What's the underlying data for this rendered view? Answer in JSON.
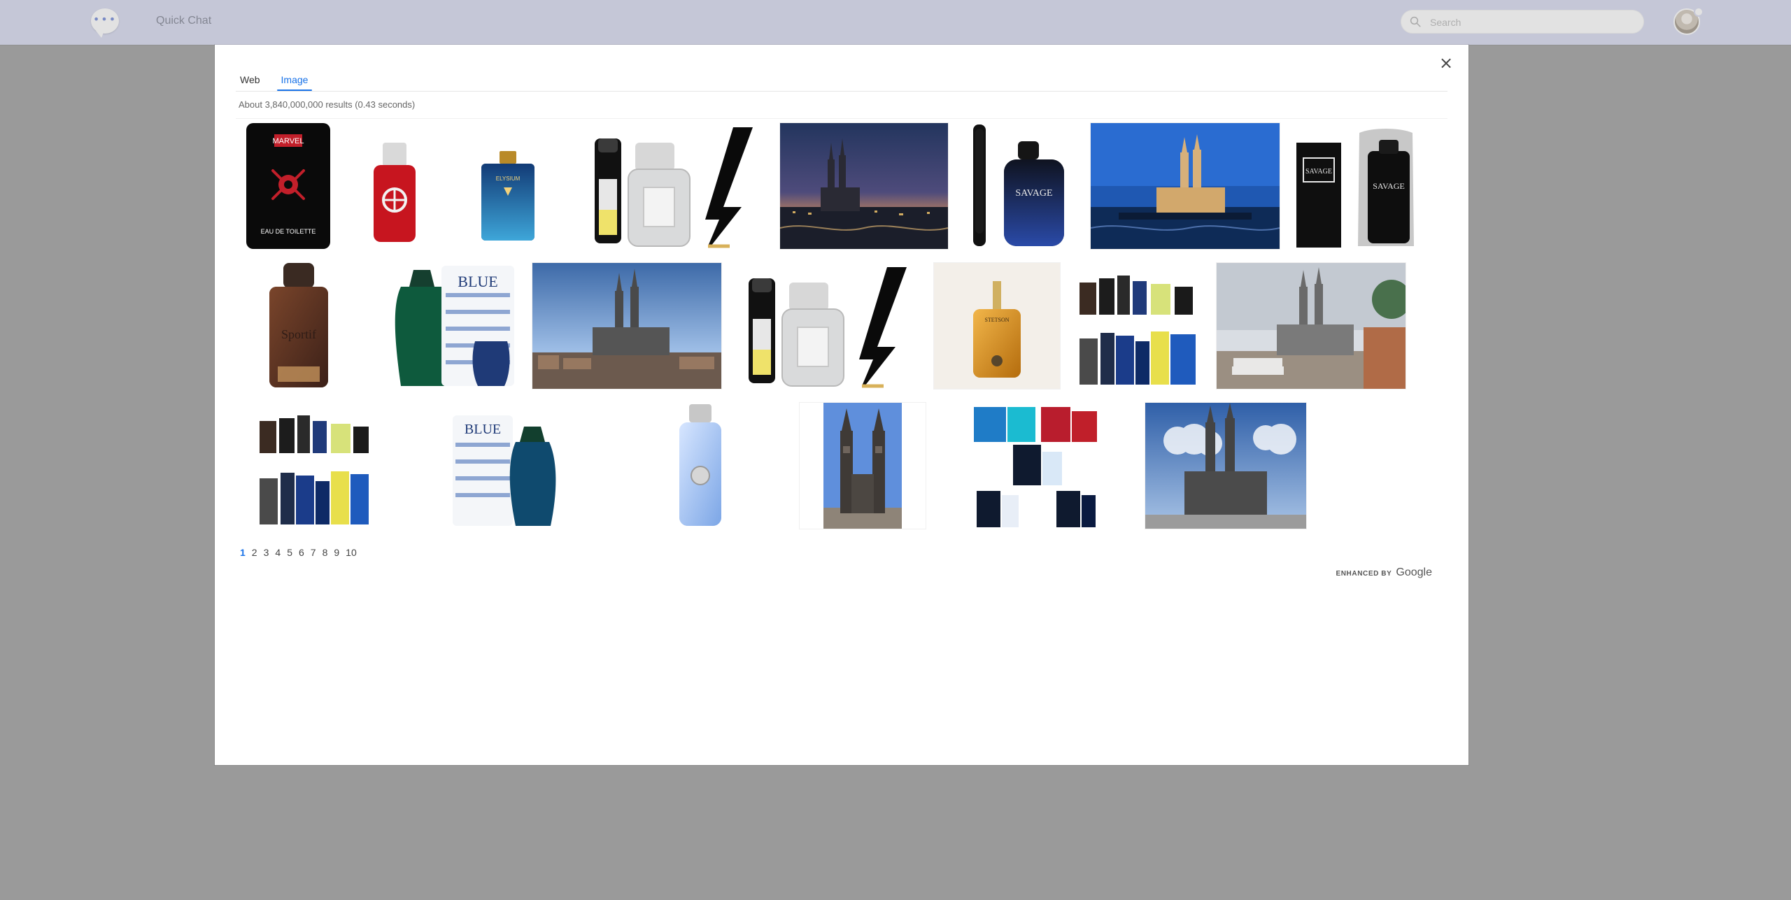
{
  "topbar": {
    "app_title": "Quick Chat",
    "search_placeholder": "Search"
  },
  "modal": {
    "tabs": [
      {
        "label": "Web",
        "active": false
      },
      {
        "label": "Image",
        "active": true
      }
    ],
    "results_stats": "About 3,840,000,000 results (0.43 seconds)",
    "pagination": {
      "pages": [
        "1",
        "2",
        "3",
        "4",
        "5",
        "6",
        "7",
        "8",
        "9",
        "10"
      ],
      "active": "1"
    },
    "footer": {
      "enhanced_by": "ENHANCED BY",
      "brand": "Google"
    },
    "rows": [
      [
        {
          "kind": "perfume_marvel",
          "logo": "MARVEL",
          "text": "EAU DE TOILETTE"
        },
        {
          "kind": "perfume_red"
        },
        {
          "kind": "perfume_blue_elysium",
          "label": "ELYSIUM"
        },
        {
          "kind": "perfume_three_lightning"
        },
        {
          "kind": "photo_city_night"
        },
        {
          "kind": "perfume_savage_mini",
          "label": "SAVAGE"
        },
        {
          "kind": "photo_cathedral_blue"
        },
        {
          "kind": "perfume_savage_pair",
          "label": "SAVAGE"
        }
      ],
      [
        {
          "kind": "perfume_brown",
          "label": "Sportif"
        },
        {
          "kind": "perfume_blue_men",
          "label": "BLUE"
        },
        {
          "kind": "photo_cathedral_river"
        },
        {
          "kind": "perfume_three_lightning_2"
        },
        {
          "kind": "perfume_stetson",
          "label": "STETSON"
        },
        {
          "kind": "perfume_set"
        },
        {
          "kind": "photo_cathedral_square"
        }
      ],
      [
        {
          "kind": "perfume_set_2"
        },
        {
          "kind": "perfume_blue_men_2",
          "label": "BLUE"
        },
        {
          "kind": "perfume_pour_homme"
        },
        {
          "kind": "photo_cathedral_tall"
        },
        {
          "kind": "perfume_mixed_boxes"
        },
        {
          "kind": "photo_cathedral_sky"
        }
      ]
    ]
  }
}
